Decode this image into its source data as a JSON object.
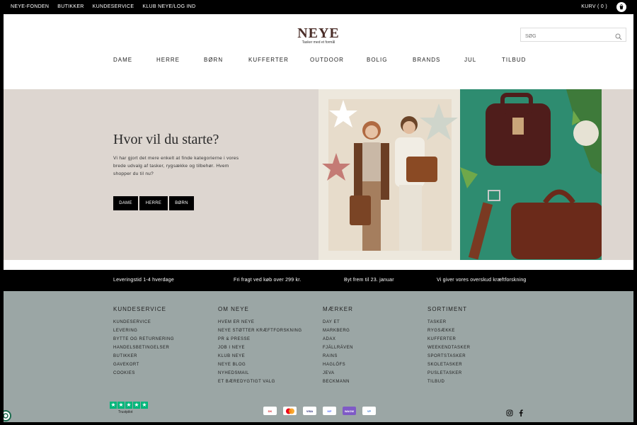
{
  "topbar": {
    "links": [
      "NEYE-FONDEN",
      "BUTIKKER",
      "KUNDESERVICE",
      "KLUB NEYE/LOG IND"
    ],
    "cart_label": "KURV ( 0 )"
  },
  "header": {
    "logo": "NEYE",
    "tagline": "Tasker med et formål",
    "search_placeholder": "SØG",
    "nav": [
      "DAME",
      "HERRE",
      "BØRN",
      "KUFFERTER",
      "OUTDOOR",
      "BOLIG",
      "BRANDS",
      "JUL",
      "TILBUD"
    ]
  },
  "hero": {
    "title": "Hvor vil du starte?",
    "text": "Vi har gjort det mere enkelt at finde kategorierne i vores brede udvalg af tasker, rygsække og tilbehør. Hvem shopper du til nu?",
    "buttons": [
      "DAME",
      "HERRE",
      "BØRN"
    ]
  },
  "usp": [
    "Leveringstid 1-4 hverdage",
    "Fri fragt ved køb over 299 kr.",
    "Byt frem til 23. januar",
    "Vi giver vores overskud kræftforskning"
  ],
  "footer": {
    "columns": [
      {
        "title": "KUNDESERVICE",
        "items": [
          "KUNDESERVICE",
          "LEVERING",
          "BYTTE OG RETURNERING",
          "HANDELSBETINGELSER",
          "BUTIKKER",
          "GAVEKORT",
          "COOKIES"
        ]
      },
      {
        "title": "OM NEYE",
        "items": [
          "HVEM ER NEYE",
          "NEYE STØTTER KRÆFTFORSKNING",
          "PR & PRESSE",
          "JOB I NEYE",
          "KLUB NEYE",
          "NEYE BLOG",
          "NYHEDSMAIL",
          "ET BÆREDYGTIGT VALG"
        ]
      },
      {
        "title": "MÆRKER",
        "items": [
          "DAY ET",
          "MARKBERG",
          "ADAX",
          "FJÄLLRÄVEN",
          "RAINS",
          "HAGLÖFS",
          "JEVA",
          "BECKMANN"
        ]
      },
      {
        "title": "SORTIMENT",
        "items": [
          "TASKER",
          "RYGSÆKKE",
          "KUFFERTER",
          "WEEKENDTASKER",
          "SPORTSTASKER",
          "SKOLETASKER",
          "PUSLETASKER",
          "TILBUD"
        ]
      }
    ],
    "trustpilot_label": "Trustpilot",
    "payments": [
      "DK",
      "MC",
      "VISA",
      "MP",
      "WAOW",
      "VP"
    ]
  },
  "colors": {
    "brand": "#4a2d28",
    "hero_bg": "#ddd6d0",
    "footer_bg": "#9ba6a5",
    "trustpilot": "#00b67a"
  }
}
